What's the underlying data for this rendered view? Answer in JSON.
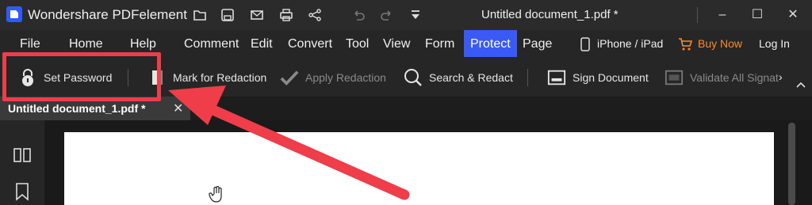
{
  "titlebar": {
    "app_name": "Wondershare PDFelement",
    "document_title": "Untitled document_1.pdf *",
    "icons": [
      "open-folder-icon",
      "save-icon",
      "mail-icon",
      "print-icon",
      "share-icon",
      "undo-icon",
      "redo-icon",
      "dropdown-icon",
      "moon-icon",
      "minimize-icon",
      "maximize-icon",
      "close-icon"
    ]
  },
  "menu": {
    "items": [
      "File",
      "Home",
      "Help",
      "Comment",
      "Edit",
      "Convert",
      "Tool",
      "View",
      "Form",
      "Protect",
      "Page"
    ],
    "active": "Protect",
    "device_label": "iPhone / iPad",
    "buy_label": "Buy Now",
    "login_label": "Log In"
  },
  "toolbar": {
    "set_password": "Set Password",
    "mark_redaction": "Mark for Redaction",
    "apply_redaction": "Apply Redaction",
    "search_redact": "Search & Redact",
    "sign_document": "Sign Document",
    "validate_signatures": "Validate All Signat"
  },
  "tab": {
    "label": "Untitled document_1.pdf *"
  },
  "colors": {
    "accent": "#3a5af5",
    "buy": "#ff8a2a",
    "annotation": "#ef3d49"
  }
}
